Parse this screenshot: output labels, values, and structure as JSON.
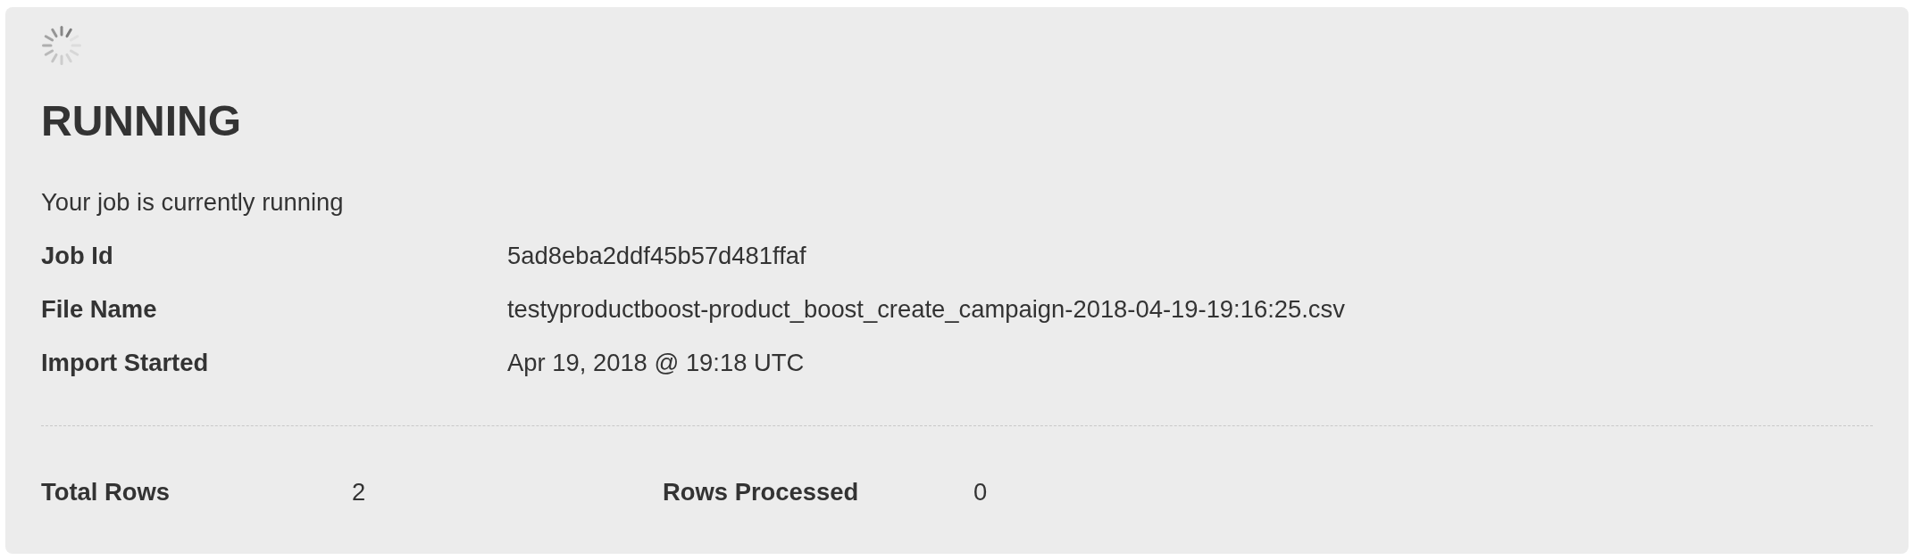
{
  "status": {
    "title": "RUNNING",
    "message": "Your job is currently running"
  },
  "details": [
    {
      "label": "Job Id",
      "value": "5ad8eba2ddf45b57d481ffaf"
    },
    {
      "label": "File Name",
      "value": "testyproductboost-product_boost_create_campaign-2018-04-19-19:16:25.csv"
    },
    {
      "label": "Import Started",
      "value": "Apr 19, 2018 @ 19:18 UTC"
    }
  ],
  "summary": [
    {
      "label": "Total Rows",
      "value": "2"
    },
    {
      "label": "Rows Processed",
      "value": "0"
    }
  ]
}
